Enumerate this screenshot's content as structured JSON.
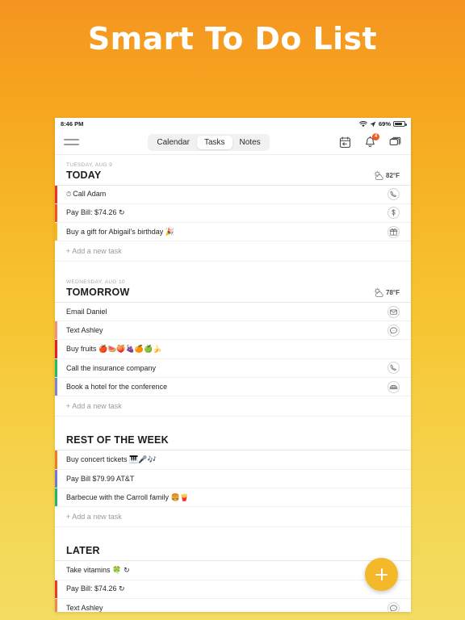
{
  "promo": {
    "title": "Smart To Do List"
  },
  "theme": {
    "bg_top": "#F59420",
    "bg_bottom": "#F4DC63",
    "accent": "#F3B92A",
    "badge": "#F4591F"
  },
  "status_bar": {
    "time": "8:46 PM",
    "wifi_icon": "wifi-icon",
    "location_icon": "location-arrow-icon",
    "battery_percent": "69%",
    "battery_icon": "battery-icon"
  },
  "navbar": {
    "menu_icon": "hamburger-menu-icon",
    "tabs": [
      {
        "label": "Calendar",
        "active": false
      },
      {
        "label": "Tasks",
        "active": true
      },
      {
        "label": "Notes",
        "active": false
      }
    ],
    "icons": [
      {
        "name": "date-picker-icon",
        "badge": null
      },
      {
        "name": "bell-icon",
        "badge": "4"
      },
      {
        "name": "layers-icon",
        "badge": null
      }
    ]
  },
  "sections": [
    {
      "date": "TUESDAY, AUG 9",
      "title": "TODAY",
      "weather_icon": "sun-behind-cloud-icon",
      "temperature": "82°F",
      "add_label": "+ Add a new task",
      "tasks": [
        {
          "text": "Call Adam",
          "lead": "⏱",
          "emoji": "",
          "stripe": "#E8342A",
          "action": "phone-icon"
        },
        {
          "text": "Pay Bill: $74.26",
          "lead": "",
          "emoji": "↻",
          "stripe": "#F1541D",
          "action": "dollar-icon"
        },
        {
          "text": "Buy a gift for Abigail's birthday",
          "lead": "",
          "emoji": "🎉",
          "stripe": "#F5B81C",
          "action": "gift-icon"
        }
      ]
    },
    {
      "date": "WEDNESDAY, AUG 10",
      "title": "TOMORROW",
      "weather_icon": "sun-behind-cloud-icon",
      "temperature": "78°F",
      "add_label": "+ Add a new task",
      "tasks": [
        {
          "text": "Email Daniel",
          "lead": "",
          "emoji": "",
          "stripe": "",
          "action": "envelope-icon"
        },
        {
          "text": "Text Ashley",
          "lead": "",
          "emoji": "",
          "stripe": "#F3907C",
          "action": "chat-bubble-icon"
        },
        {
          "text": "Buy fruits",
          "lead": "",
          "emoji": "🍎🍉🍑🍇🍊🍏🍌",
          "stripe": "#E8201A",
          "action": ""
        },
        {
          "text": "Call the insurance company",
          "lead": "",
          "emoji": "",
          "stripe": "#1FBF5E",
          "action": "phone-icon"
        },
        {
          "text": "Book a hotel for the conference",
          "lead": "",
          "emoji": "",
          "stripe": "#7C84D8",
          "action": "hotel-bed-icon"
        }
      ]
    },
    {
      "date": "",
      "title": "REST OF THE WEEK",
      "weather_icon": "",
      "temperature": "",
      "add_label": "+ Add a new task",
      "tasks": [
        {
          "text": "Buy concert tickets",
          "lead": "",
          "emoji": "🎹🎤🎶",
          "stripe": "#F47A1E",
          "action": ""
        },
        {
          "text": "Pay Bill $79.99 AT&T",
          "lead": "",
          "emoji": "",
          "stripe": "#6E79D6",
          "action": ""
        },
        {
          "text": "Barbecue with the Carroll family",
          "lead": "",
          "emoji": "🍔🍟",
          "stripe": "#20B85A",
          "action": ""
        }
      ]
    },
    {
      "date": "",
      "title": "LATER",
      "weather_icon": "",
      "temperature": "",
      "add_label": "",
      "tasks": [
        {
          "text": "Take vitamins",
          "lead": "",
          "emoji": "🍀 ↻",
          "stripe": "",
          "action": ""
        },
        {
          "text": "Pay Bill: $74.26",
          "lead": "",
          "emoji": "↻",
          "stripe": "#EE3B1B",
          "action": ""
        },
        {
          "text": "Text Ashley",
          "lead": "",
          "emoji": "",
          "stripe": "#F08A42",
          "action": "chat-bubble-icon"
        }
      ]
    }
  ],
  "fab": {
    "label": "+",
    "name": "add-task-fab"
  }
}
